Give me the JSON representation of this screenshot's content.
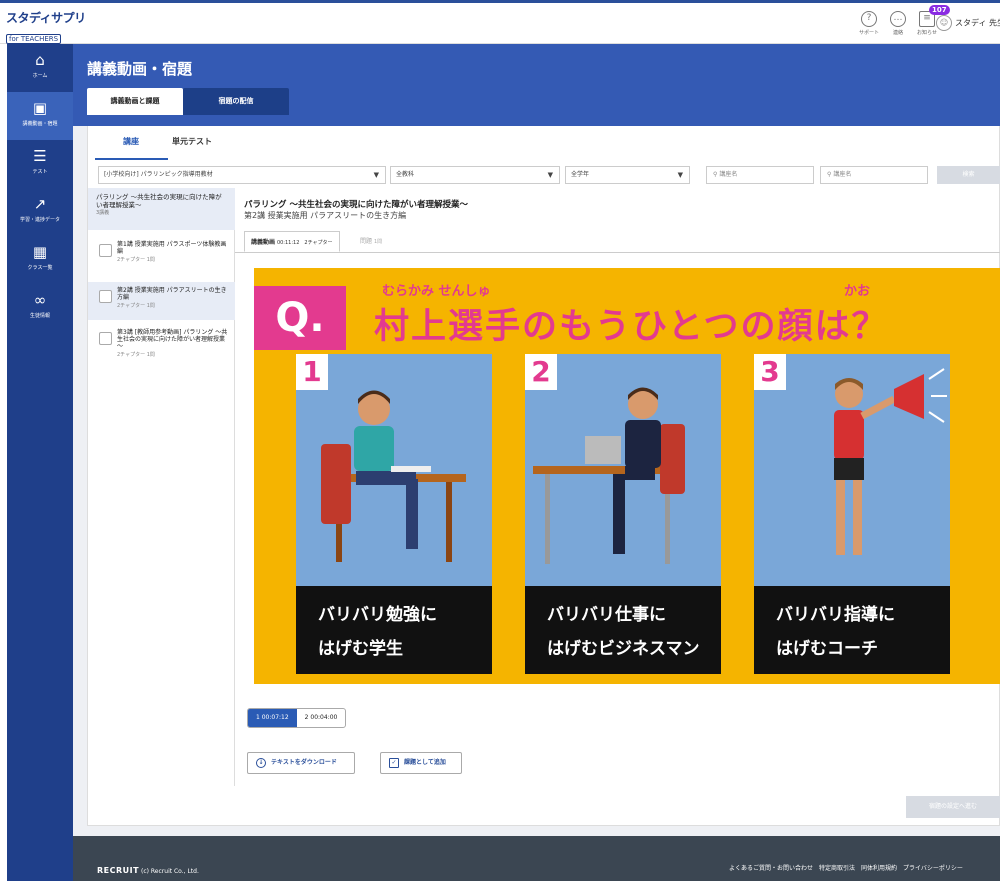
{
  "app": {
    "logo": "スタディサプリ",
    "logo_sub": "for TEACHERS"
  },
  "topbar": {
    "support": "サポート",
    "contact": "連絡",
    "notice": "お知らせ",
    "notice_badge": "107",
    "user_name": "スタディ 先生"
  },
  "sidebar": {
    "items": [
      {
        "label": "ホーム",
        "icon": "home-icon"
      },
      {
        "label": "講義動画・宿題",
        "icon": "video-icon"
      },
      {
        "label": "テスト",
        "icon": "test-icon"
      },
      {
        "label": "学習・進捗データ",
        "icon": "chart-icon"
      },
      {
        "label": "クラス一覧",
        "icon": "class-icon"
      },
      {
        "label": "生徒情報",
        "icon": "students-icon"
      }
    ]
  },
  "header": {
    "title": "講義動画・宿題",
    "tabs": [
      "講義動画と課題",
      "宿題の配信"
    ]
  },
  "subtabs": [
    "講座",
    "単元テスト"
  ],
  "filters": {
    "course": "[小学校向け] パラリンピック指導用教材",
    "subject": "全教科",
    "grade": "全学年",
    "search1_placeholder": "講座名",
    "search2_placeholder": "講座名",
    "search_button": "検索"
  },
  "course_list": {
    "head_title": "パラリング ～共生社会の実現に向けた障がい者理解授業～",
    "head_meta": "3講義",
    "lectures": [
      {
        "title": "第1講 授業実施用 パラスポーツ体験教画編",
        "meta": "2チャプター 1問"
      },
      {
        "title": "第2講 授業実施用 パラアスリートの生き方編",
        "meta": "2チャプター 1問"
      },
      {
        "title": "第3講 [教師用参考動画] パラリング ～共生社会の実現に向けた障がい者理解授業～",
        "meta": "2チャプター 1問"
      }
    ]
  },
  "main": {
    "title": "パラリング ～共生社会の実現に向けた障がい者理解授業～",
    "subtitle": "第2講 授業実施用 パラアスリートの生き方編",
    "video_tab": "講義動画",
    "video_tab_meta": "00:11:12　2チャプター",
    "question_tab": "問題",
    "question_tab_meta": "1問"
  },
  "video": {
    "q_label": "Q.",
    "question": "村上選手のもうひとつの顔は？",
    "ruby1": "むらかみ せんしゅ",
    "ruby2": "かお",
    "choices": [
      {
        "num": "1",
        "line1": "バリバリ勉強に",
        "line2": "はげむ学生"
      },
      {
        "num": "2",
        "line1": "バリバリ仕事に",
        "line2": "はげむビジネスマン"
      },
      {
        "num": "3",
        "line1": "バリバリ指導に",
        "line2": "はげむコーチ"
      }
    ]
  },
  "chapters": [
    "1 00:07:12",
    "2 00:04:00"
  ],
  "actions": {
    "download": "テキストをダウンロード",
    "add_task": "課題として追加"
  },
  "assign_button": "宿題の設定へ進む",
  "footer": {
    "brand": "RECRUIT",
    "copyright": "(c) Recruit Co., Ltd.",
    "links": "よくあるご質問・お問い合わせ　特定商取引法　同体利用規約　プライバシーポリシー"
  }
}
